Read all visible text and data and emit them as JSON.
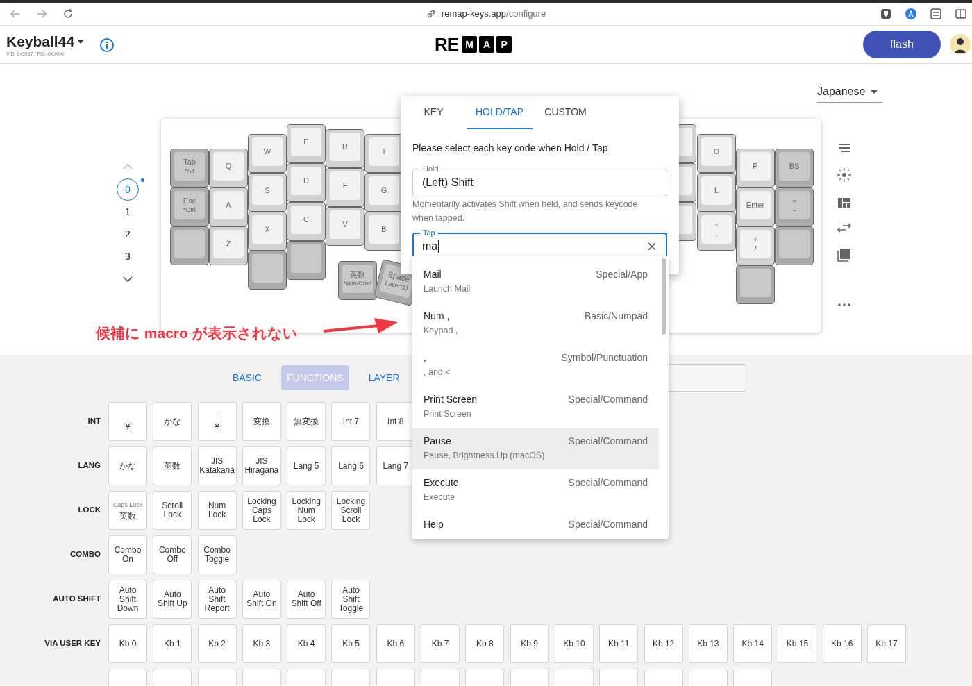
{
  "browser": {
    "url_host": "remap-keys.app",
    "url_path": "/configure"
  },
  "header": {
    "keyboard_name": "Keyball44",
    "device_ids": "VID: 0x5957 / PID: 0x0400",
    "logo_plain": "RE",
    "logo_boxed": [
      "M",
      "A",
      "P"
    ],
    "flash_button": "flash"
  },
  "language": "Japanese",
  "layers": [
    {
      "label": "0",
      "selected": true,
      "modified": true
    },
    {
      "label": "1",
      "selected": false,
      "modified": false
    },
    {
      "label": "2",
      "selected": false,
      "modified": false
    },
    {
      "label": "3",
      "selected": false,
      "modified": false
    }
  ],
  "keyboard": {
    "keys": [
      {
        "kind": "mod",
        "label": "Tab",
        "sub": "*Alt"
      },
      {
        "kind": "mod",
        "label": "Esc",
        "sub": "*Ctrl"
      },
      {
        "kind": "mod"
      },
      {
        "kind": "alpha",
        "label": "Q"
      },
      {
        "kind": "alpha",
        "label": "A"
      },
      {
        "kind": "alpha",
        "label": "Z"
      },
      {
        "kind": "alpha",
        "label": "W"
      },
      {
        "kind": "alpha",
        "label": "S"
      },
      {
        "kind": "alpha",
        "label": "X"
      },
      {
        "kind": "mod"
      },
      {
        "kind": "alpha",
        "label": "E"
      },
      {
        "kind": "alpha",
        "label": "D"
      },
      {
        "kind": "alpha",
        "label": "C"
      },
      {
        "kind": "mod"
      },
      {
        "kind": "alpha",
        "label": "R"
      },
      {
        "kind": "alpha",
        "label": "F"
      },
      {
        "kind": "alpha",
        "label": "V"
      },
      {
        "kind": "alpha",
        "label": "T"
      },
      {
        "kind": "alpha",
        "label": "G"
      },
      {
        "kind": "alpha",
        "label": "B"
      },
      {
        "kind": "mod",
        "label": "英数",
        "sub": "*Win/Cmd"
      },
      {
        "kind": "mod",
        "label": "Space",
        "sub": "Layer(1)"
      },
      {
        "kind": "alpha"
      },
      {
        "kind": "alpha"
      },
      {
        "kind": "alpha"
      },
      {
        "kind": "alpha",
        "label": "O"
      },
      {
        "kind": "alpha",
        "label": "L"
      },
      {
        "kind": "alpha",
        "top": ">",
        "label": "."
      },
      {
        "kind": "alpha",
        "label": "P"
      },
      {
        "kind": "alpha",
        "label": "Enter"
      },
      {
        "kind": "alpha",
        "top": "?",
        "label": "/"
      },
      {
        "kind": "mod"
      },
      {
        "kind": "mod",
        "label": "BS"
      },
      {
        "kind": "mod",
        "top": "=",
        "label": "-"
      },
      {
        "kind": "mod"
      }
    ]
  },
  "annotation": "候補に macro が表示されない",
  "category_tabs": [
    {
      "label": "BASIC",
      "selected": false
    },
    {
      "label": "FUNCTIONS",
      "selected": true
    },
    {
      "label": "LAYER",
      "selected": false
    }
  ],
  "function_rows": [
    {
      "label": "INT",
      "keys": [
        {
          "top": "_",
          "label": "¥"
        },
        {
          "label": "かな"
        },
        {
          "top": "|",
          "label": "¥"
        },
        {
          "label": "変換"
        },
        {
          "label": "無変換"
        },
        {
          "label": "Int 7"
        },
        {
          "label": "Int 8"
        }
      ]
    },
    {
      "label": "LANG",
      "keys": [
        {
          "label": "かな"
        },
        {
          "label": "英数"
        },
        {
          "label": "JIS\nKatakana"
        },
        {
          "label": "JIS\nHiragana"
        },
        {
          "label": "Lang 5"
        },
        {
          "label": "Lang 6"
        },
        {
          "label": "Lang 7"
        }
      ]
    },
    {
      "label": "LOCK",
      "keys": [
        {
          "top": "Caps Lock",
          "label": "英数"
        },
        {
          "label": "Scroll\nLock"
        },
        {
          "label": "Num\nLock"
        },
        {
          "label": "Locking\nCaps\nLock"
        },
        {
          "label": "Locking\nNum\nLock"
        },
        {
          "label": "Locking\nScroll\nLock"
        }
      ]
    },
    {
      "label": "COMBO",
      "keys": [
        {
          "label": "Combo\nOn"
        },
        {
          "label": "Combo\nOff"
        },
        {
          "label": "Combo\nToggle"
        }
      ]
    },
    {
      "label": "AUTO SHIFT",
      "keys": [
        {
          "label": "Auto\nShift\nDown"
        },
        {
          "label": "Auto\nShift Up"
        },
        {
          "label": "Auto\nShift\nReport"
        },
        {
          "label": "Auto\nShift On"
        },
        {
          "label": "Auto\nShift Off"
        },
        {
          "label": "Auto\nShift\nToggle"
        }
      ]
    },
    {
      "label": "VIA USER KEY",
      "keys": [
        {
          "label": "Kb 0"
        },
        {
          "label": "Kb 1"
        },
        {
          "label": "Kb 2"
        },
        {
          "label": "Kb 3"
        },
        {
          "label": "Kb 4"
        },
        {
          "label": "Kb 5"
        },
        {
          "label": "Kb 6"
        },
        {
          "label": "Kb 7"
        },
        {
          "label": "Kb 8"
        },
        {
          "label": "Kb 9"
        },
        {
          "label": "Kb 10"
        },
        {
          "label": "Kb 11"
        },
        {
          "label": "Kb 12"
        },
        {
          "label": "Kb 13"
        },
        {
          "label": "Kb 14"
        },
        {
          "label": "Kb 15"
        },
        {
          "label": "Kb 16"
        },
        {
          "label": "Kb 17"
        }
      ]
    }
  ],
  "popup": {
    "tabs": [
      {
        "label": "KEY",
        "selected": false
      },
      {
        "label": "HOLD/TAP",
        "selected": true
      },
      {
        "label": "CUSTOM",
        "selected": false
      }
    ],
    "prompt": "Please select each key code when Hold / Tap",
    "hold": {
      "legend": "Hold",
      "value": "(Left) Shift"
    },
    "helper": "Momentarily activates Shift when held, and sends keycode when tapped.",
    "tap": {
      "legend": "Tap",
      "value": "ma"
    },
    "suggestions": [
      {
        "name": "Mail",
        "description": "Launch Mail",
        "category": "Special/App",
        "highlighted": false
      },
      {
        "name": "Num ,",
        "description": "Keypad ,",
        "category": "Basic/Numpad",
        "highlighted": false
      },
      {
        "name": ",",
        "description": ", and <",
        "category": "Symbol/Punctuation",
        "highlighted": false
      },
      {
        "name": "Print Screen",
        "description": "Print Screen",
        "category": "Special/Command",
        "highlighted": false
      },
      {
        "name": "Pause",
        "description": "Pause, Brightness Up (macOS)",
        "category": "Special/Command",
        "highlighted": true
      },
      {
        "name": "Execute",
        "description": "Execute",
        "category": "Special/Command",
        "highlighted": false
      },
      {
        "name": "Help",
        "category": "Special/Command",
        "highlighted": false
      }
    ]
  }
}
